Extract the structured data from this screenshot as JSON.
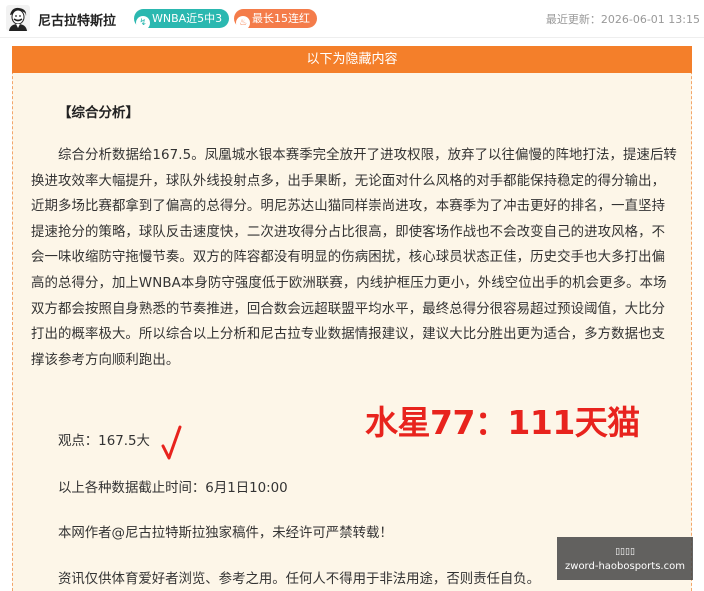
{
  "header": {
    "author_name": "尼古拉特斯拉",
    "avatar_icon": "portrait-avatar",
    "badges": [
      {
        "label": "WNBA近5中3",
        "icon": "tag-icon",
        "color": "#2bb8b0"
      },
      {
        "label": "最长15连红",
        "icon": "flame-icon",
        "color": "#f47c4a"
      }
    ],
    "last_updated": "最近更新：2026-06-01 13:15"
  },
  "panel": {
    "bar_text": "以下为隐藏内容",
    "bar_color": "#f47f2a",
    "heading": "【综合分析】",
    "paragraph": "综合分析数据给167.5。凤凰城水银本赛季完全放开了进攻权限，放弃了以往偏慢的阵地打法，提速后转换进攻效率大幅提升，球队外线投射点多，出手果断，无论面对什么风格的对手都能保持稳定的得分输出，近期多场比赛都拿到了偏高的总得分。明尼苏达山猫同样崇尚进攻，本赛季为了冲击更好的排名，一直坚持提速抢分的策略，球队反击速度快，二次进攻得分占比很高，即使客场作战也不会改变自己的进攻风格，不会一味收缩防守拖慢节奏。双方的阵容都没有明显的伤病困扰，核心球员状态正佳，历史交手也大多打出偏高的总得分，加上WNBA本身防守强度低于欧洲联赛，内线护框压力更小，外线空位出手的机会更多。本场双方都会按照自身熟悉的节奏推进，回合数会远超联盟平均水平，最终总得分很容易超过预设阈值，大比分打出的概率极大。所以综合以上分析和尼古拉专业数据情报建议，建议大比分胜出更为适合，多方数据也支撑该参考方向顺利跑出。",
    "viewpoint": "观点：167.5大",
    "check_icon": "checkmark-icon",
    "cutoff": "以上各种数据截止时间：6月1日10:00",
    "copyright": "本网作者@尼古拉特斯拉独家稿件，未经许可严禁转载！",
    "disclaimer": "资讯仅供体育爱好者浏览、参考之用。任何人不得用于非法用途，否则责任自负。"
  },
  "score_overlay": {
    "text": "水星77：111天猫",
    "color": "#e8231d"
  },
  "watermark": {
    "line1": "▯▯▯▯",
    "line2": "zword-haobosports.com"
  }
}
